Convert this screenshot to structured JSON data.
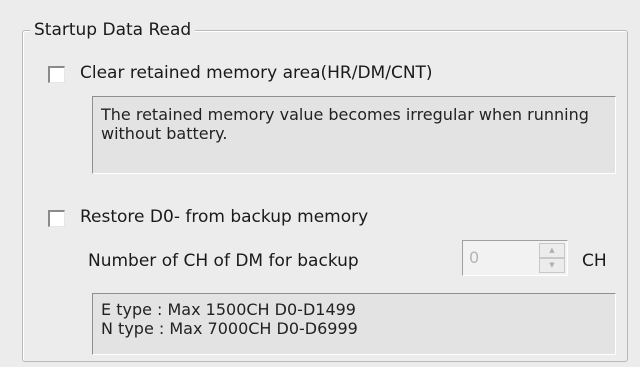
{
  "group": {
    "title": "Startup Data Read"
  },
  "clear_retained": {
    "label": "Clear retained memory area(HR/DM/CNT)",
    "checked": false,
    "note": "The retained memory value becomes irregular when running without battery."
  },
  "restore": {
    "label": "Restore D0- from backup memory",
    "checked": false,
    "count_label": "Number of CH of DM for backup",
    "count_value": "0",
    "unit": "CH",
    "info_lines": [
      "E type : Max 1500CH  D0-D1499",
      "N type : Max 7000CH  D0-D6999"
    ]
  },
  "icons": {
    "spin_up": "spin-up-arrow-icon",
    "spin_down": "spin-down-arrow-icon"
  }
}
